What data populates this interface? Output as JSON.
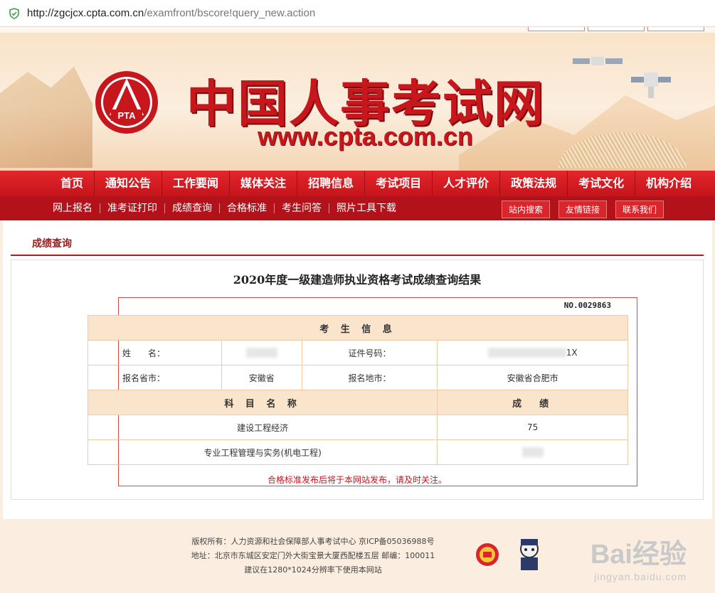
{
  "browser": {
    "url_host": "http://zgcjcx.cpta.com.cn",
    "url_path": "/examfront/bscore!query_new.action"
  },
  "banner": {
    "title": "中国人事考试网",
    "site": "www.cpta.com.cn",
    "logo_text": "PTA"
  },
  "main_nav": [
    "首页",
    "通知公告",
    "工作要闻",
    "媒体关注",
    "招聘信息",
    "考试项目",
    "人才评价",
    "政策法规",
    "考试文化",
    "机构介绍"
  ],
  "sub_nav": [
    "网上报名",
    "准考证打印",
    "成绩查询",
    "合格标准",
    "考生问答",
    "照片工具下载"
  ],
  "right_buttons": [
    "站内搜索",
    "友情链接",
    "联系我们"
  ],
  "section_title": "成绩查询",
  "result": {
    "title": "2020年度一级建造师执业资格考试成绩查询结果",
    "serial": "NO.0029863",
    "info_header": "考 生 信 息",
    "name_label": "姓　　名：",
    "id_label": "证件号码：",
    "id_suffix": "1X",
    "province_label": "报名省市：",
    "province_value": "安徽省",
    "city_label": "报名地市：",
    "city_value": "安徽省合肥市",
    "subject_header": "科 目 名 称",
    "score_header": "成　绩",
    "subjects": [
      {
        "name": "建设工程经济",
        "score": "75"
      },
      {
        "name": "专业工程管理与实务(机电工程)",
        "score": ""
      }
    ],
    "notice": "合格标准发布后将于本网站发布，请及时关注。"
  },
  "footer": {
    "line1": "版权所有：人力资源和社会保障部人事考试中心 京ICP备05036988号",
    "line2": "地址：北京市东城区安定门外大街宝景大厦西配楼五层 邮编：100011",
    "line3": "建议在1280*1024分辨率下使用本网站"
  },
  "watermark": {
    "brand": "Bai经验",
    "site": "jingyan.baidu.com"
  },
  "colors": {
    "brand_red": "#c8161d",
    "nav_red": "#e3262c",
    "sub_nav_red": "#b3121a",
    "table_head": "#fbe4cc"
  }
}
